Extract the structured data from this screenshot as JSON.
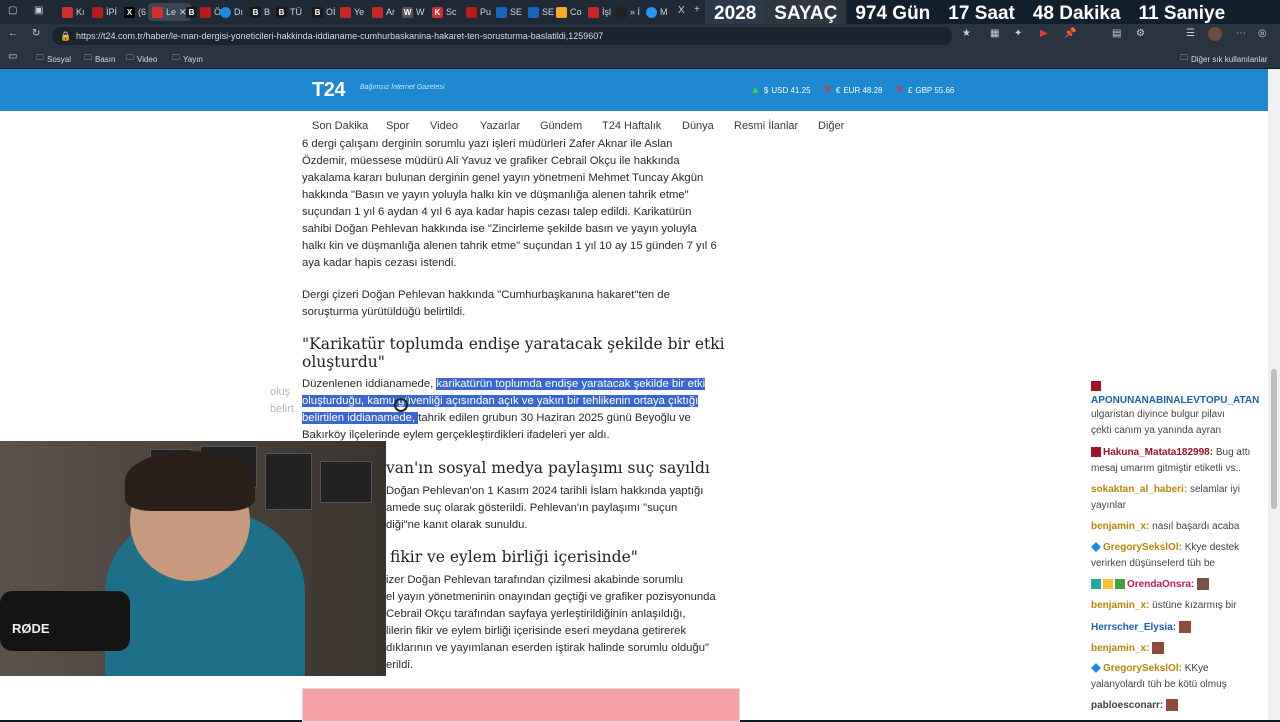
{
  "tabs": [
    "Kı",
    "İPİ",
    "(6",
    "Le",
    "B",
    "Öz",
    "Dı",
    "B",
    "Bİ",
    "TÜ",
    "Oİ",
    "Ye",
    "Ar",
    "W",
    "Sc",
    "Pu",
    "SE",
    "SE",
    "Co",
    "İşl",
    "» İ",
    "M"
  ],
  "counter": {
    "year": "2028",
    "label": "SAYAÇ",
    "days": "974 Gün",
    "hours": "17 Saat",
    "minutes": "48 Dakika",
    "seconds": "11 Saniye"
  },
  "address": {
    "url": "https://t24.com.tr/haber/le-man-dergisi-yoneticileri-hakkinda-iddianame-cumhurbaskanina-hakaret-ten-sorusturma-baslatildi,1259607"
  },
  "bookmarks": {
    "items": [
      "Sosyal",
      "Basın",
      "Video",
      "Yayın"
    ],
    "other": "Diğer sık kullanılanlar"
  },
  "site": {
    "logo": "T24",
    "tagline": "Bağımsız İnternet Gazetesi"
  },
  "rates": [
    {
      "label": "USD 41.25",
      "direction": "up",
      "color": "#3fcf3f",
      "symbol": "$"
    },
    {
      "label": "EUR 48.28",
      "direction": "down",
      "color": "#d23a3a",
      "symbol": "€"
    },
    {
      "label": "GBP 55.66",
      "direction": "down",
      "color": "#d23a3a",
      "symbol": "£"
    }
  ],
  "nav": [
    "Son Dakika",
    "Spor",
    "Video",
    "Yazarlar",
    "Gündem",
    "T24 Haftalık",
    "Dünya",
    "Resmi İlanlar",
    "Diğer"
  ],
  "article": {
    "p1_lines": [
      "6 dergi çalışanı derginin sorumlu yazı işleri müdürleri Zafer Aknar ile Aslan",
      "Özdemir, müessese müdürü Ali Yavuz ve grafiker Cebrail Okçu ile hakkında",
      "yakalama kararı bulunan derginin genel yayın yönetmeni Mehmet Tuncay Akgün",
      "hakkında \"Basın ve yayın yoluyla halkı kin ve düşmanlığa alenen tahrik etme\"",
      "suçundan 1 yıl 6 aydan 4 yıl 6 aya kadar hapis cezası talep edildi. Karikatürün",
      "sahibi Doğan Pehlevan hakkında ise \"Zincirleme şekilde basın ve yayın yoluyla",
      "halkı kin ve düşmanlığa alenen tahrik etme\" suçundan 1 yıl 10 ay 15 günden 7 yıl 6",
      "aya kadar hapis cezası istendi."
    ],
    "p2_lines": [
      "Dergi çizeri Doğan Pehlevan hakkında \"Cumhurbaşkanına hakaret\"ten de",
      "soruşturma yürütüldüğü belirtildi."
    ],
    "h1_lines": [
      "\"Karikatür toplumda endişe yaratacak şekilde bir etki",
      "oluşturdu\""
    ],
    "p3": {
      "l1_pre": "Düzenlenen iddianamede, ",
      "l1_hl": "karikatürün toplumda endişe yaratacak şekilde bir etki",
      "l2_hl": "oluşturduğu, kamu güvenliği açısından açık ve yakın bir tehlikenin ortaya çıktığı",
      "l3_hl": "belirtilen iddianamede, ",
      "l3_post": "tahrik edilen grubun 30 Haziran 2025 günü Beyoğlu ve",
      "l4": "Bakırköy ilçelerinde eylem gerçekleştirdikleri ifadeleri yer aldı."
    },
    "h2": "van'ın sosyal medya paylaşımı suç sayıldı",
    "p4_lines": [
      "Doğan Pehlevan'on 1 Kasım 2024 tarihli İslam hakkında yaptığı",
      "amede suç olarak gösterildi. Pehlevan'ın paylaşımı \"suçun",
      "diği\"ne kanıt olarak sunuldu."
    ],
    "h3": "fikir ve eylem birliği içerisinde\"",
    "p5_lines": [
      "izer Doğan Pehlevan tarafından çizilmesi akabinde sorumlu",
      "el yayın yönetmeninin onayından geçtiği ve grafiker pozisyonunda",
      " Cebrail Okçu tarafından sayfaya yerleştirildiğinin anlaşıldığı,",
      "lilerin fikir ve eylem birliği içerisinde eseri meydana getirerek",
      "dıklarının ve yayımlanan eserden iştirak halinde sorumlu olduğu\"",
      "erildi."
    ],
    "ghost_lines": [
      "oluş",
      "belirt"
    ]
  },
  "webcam": {
    "brand": "RØDE"
  },
  "chat": [
    {
      "user": "APONUNANABINALEVTOPU_ATAN",
      "text": "",
      "color": "#1e5fb4"
    },
    {
      "user": "",
      "text": "ulgaristan diyince bulgur pilavı",
      "color": "#444"
    },
    {
      "user": "",
      "text": "çekti canım ya yanında ayran",
      "color": "#444"
    },
    {
      "user": "Hakuna_Matata182998:",
      "text": "Bug attı",
      "color": "#a0142a"
    },
    {
      "user": "",
      "text": "mesaj umarım gitmiştir etiketli vs..",
      "color": "#444"
    },
    {
      "user": "sokaktan_al_haberi:",
      "text": "selamlar iyi",
      "color": "#b8860b"
    },
    {
      "user": "",
      "text": "yayınlar",
      "color": "#444"
    },
    {
      "user": "benjamin_x:",
      "text": "nasıl başardı acaba",
      "color": "#b8860b"
    },
    {
      "user": "GregorySekslOl:",
      "text": "Kkye destek",
      "color": "#b8860b"
    },
    {
      "user": "",
      "text": "verirken düşünseIerd tüh be",
      "color": "#444"
    },
    {
      "user": "OrendaOnsra:",
      "text": "",
      "color": "#c2185b"
    },
    {
      "user": "benjamin_x:",
      "text": "üstüne kızarmış bir",
      "color": "#b8860b"
    },
    {
      "user": "Herrscher_Elysia:",
      "text": "",
      "color": "#1e5fb4"
    },
    {
      "user": "benjamin_x:",
      "text": "",
      "color": "#b8860b"
    },
    {
      "user": "GregorySekslOl:",
      "text": "KKye",
      "color": "#b8860b"
    },
    {
      "user": "",
      "text": "yalanyolardı tüh be kötü olmuş",
      "color": "#444"
    },
    {
      "user": "pabloesconarr:",
      "text": "",
      "color": "#444"
    }
  ]
}
